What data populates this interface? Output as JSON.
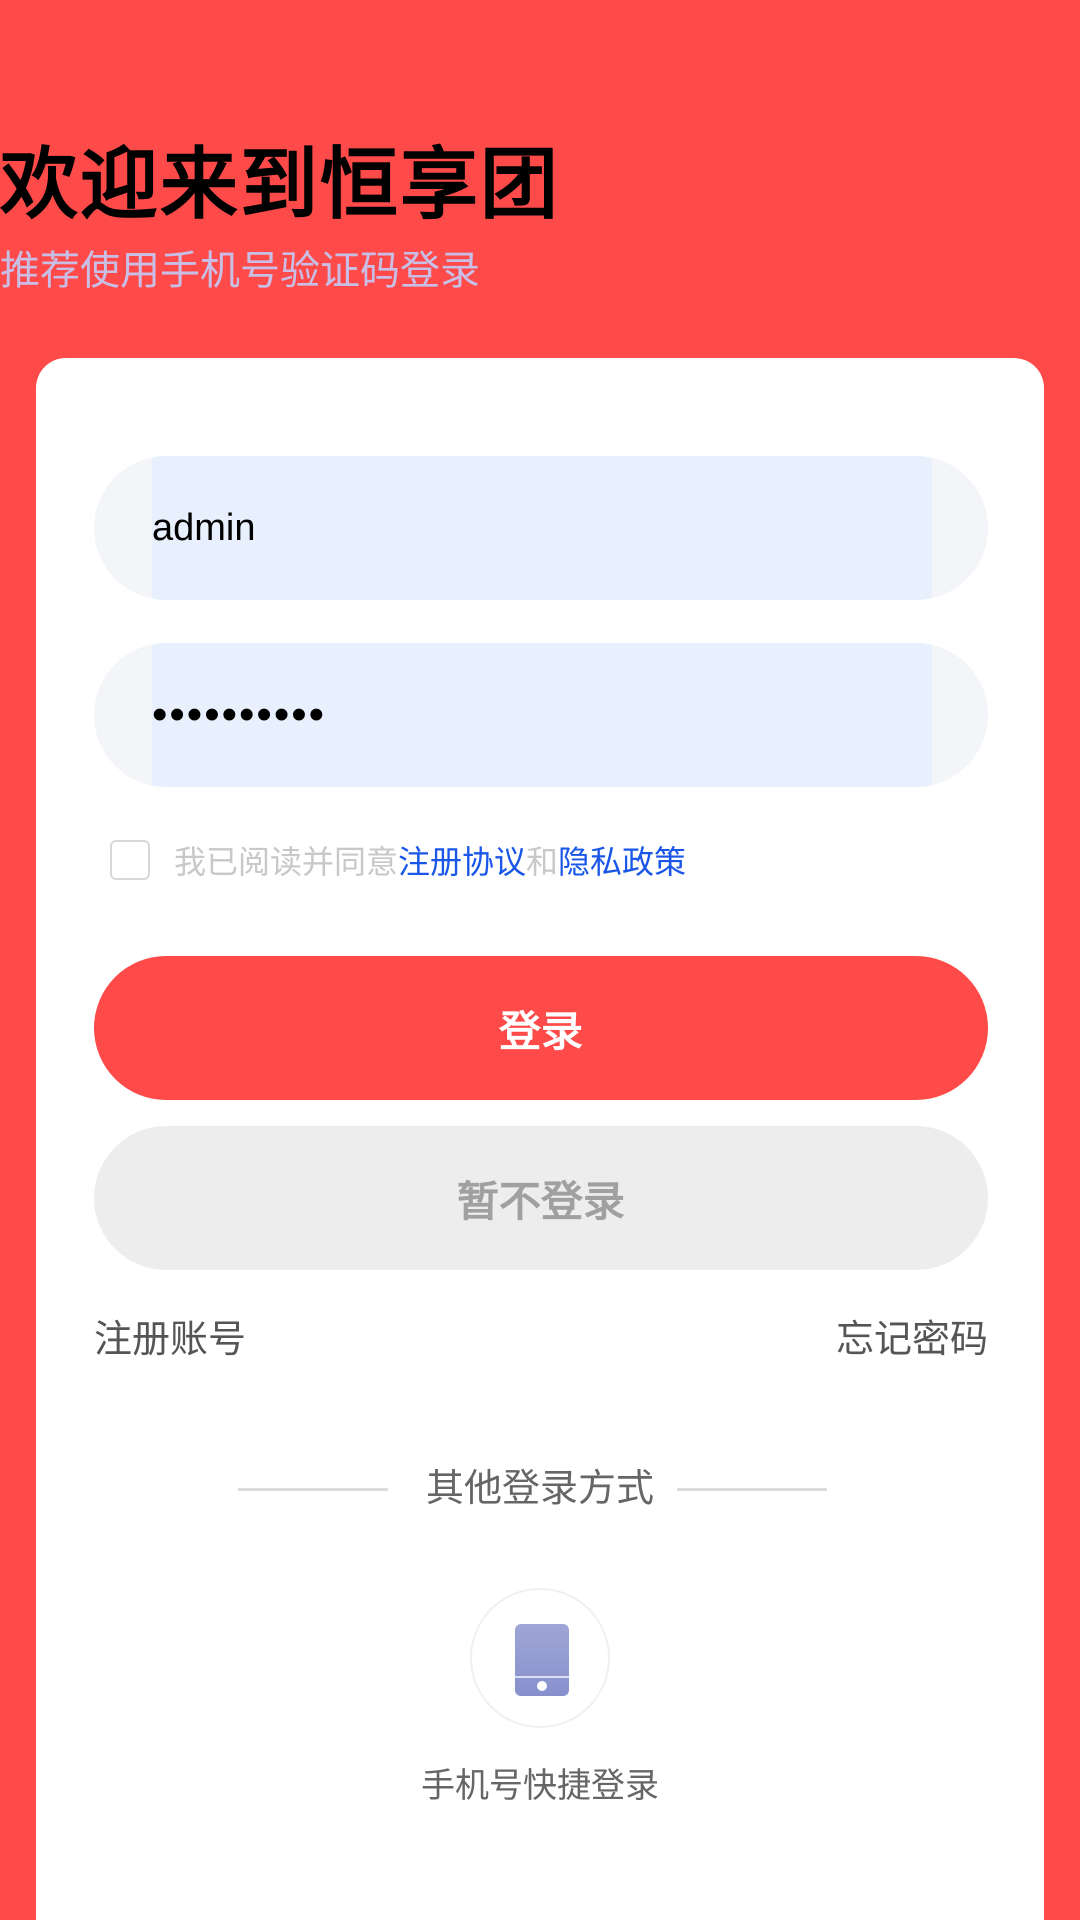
{
  "header": {
    "title": "欢迎来到恒享团",
    "subtitle": "推荐使用手机号验证码登录"
  },
  "form": {
    "username_value": "admin",
    "password_value": "••••••••••"
  },
  "agreement": {
    "prefix": "我已阅读并同意",
    "link1": "注册协议",
    "middle": "和",
    "link2": "隐私政策",
    "checked": false
  },
  "buttons": {
    "login_label": "登录",
    "skip_label": "暂不登录"
  },
  "links": {
    "register": "注册账号",
    "forgot": "忘记密码"
  },
  "other": {
    "divider_text": "其他登录方式",
    "phone_login_label": "手机号快捷登录",
    "phone_icon": "phone-icon"
  },
  "colors": {
    "brand": "#ff4a4a",
    "link": "#1a56e8",
    "icon": "#8f98d0"
  }
}
